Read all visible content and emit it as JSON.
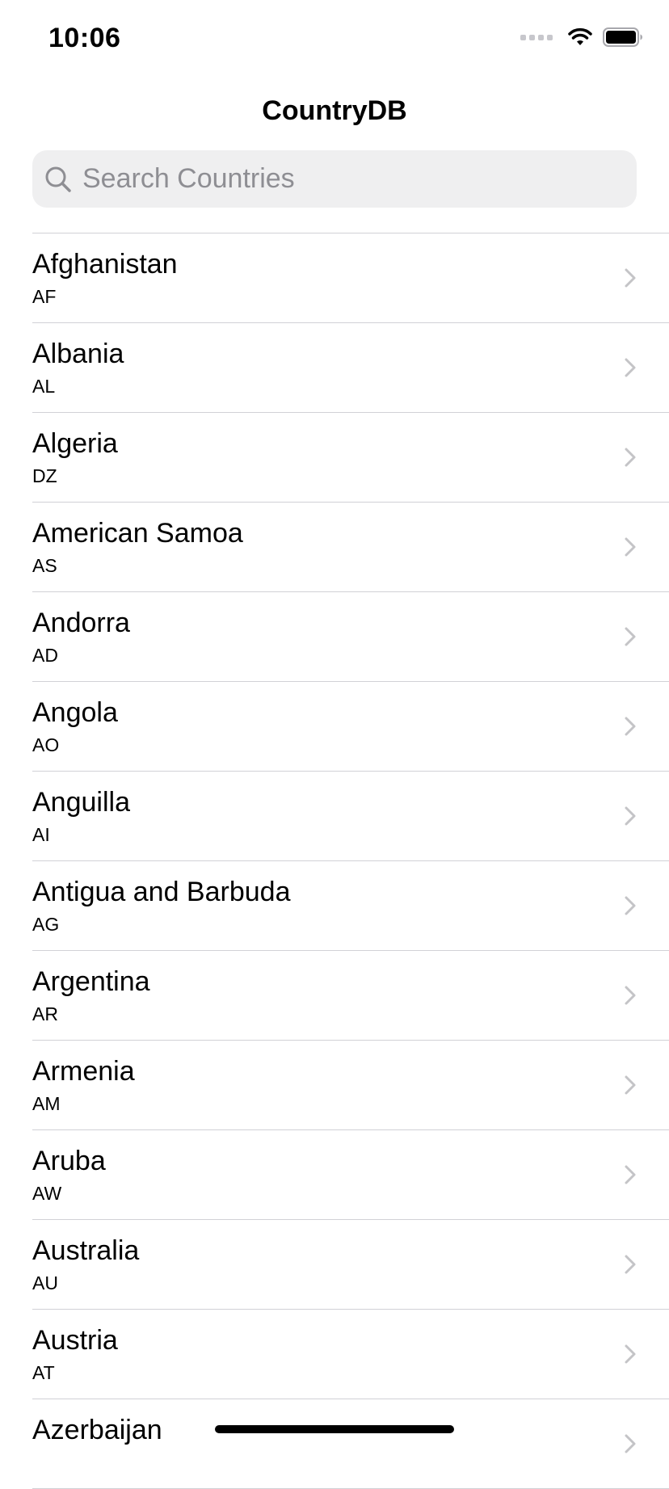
{
  "status_bar": {
    "time": "10:06"
  },
  "nav": {
    "title": "CountryDB"
  },
  "search": {
    "placeholder": "Search Countries",
    "value": ""
  },
  "countries": [
    {
      "name": "Afghanistan",
      "code": "AF"
    },
    {
      "name": "Albania",
      "code": "AL"
    },
    {
      "name": "Algeria",
      "code": "DZ"
    },
    {
      "name": "American Samoa",
      "code": "AS"
    },
    {
      "name": "Andorra",
      "code": "AD"
    },
    {
      "name": "Angola",
      "code": "AO"
    },
    {
      "name": "Anguilla",
      "code": "AI"
    },
    {
      "name": "Antigua and Barbuda",
      "code": "AG"
    },
    {
      "name": "Argentina",
      "code": "AR"
    },
    {
      "name": "Armenia",
      "code": "AM"
    },
    {
      "name": "Aruba",
      "code": "AW"
    },
    {
      "name": "Australia",
      "code": "AU"
    },
    {
      "name": "Austria",
      "code": "AT"
    },
    {
      "name": "Azerbaijan",
      "code": ""
    }
  ],
  "icons": {
    "search": "search-icon",
    "chevron": "chevron-right-icon",
    "wifi": "wifi-icon",
    "battery": "battery-icon",
    "signal": "cellular-signal-icon"
  },
  "colors": {
    "separator": "#d1d1d6",
    "search_background": "#efeff0",
    "placeholder": "#8e8e93",
    "chevron": "#c4c4c7"
  }
}
